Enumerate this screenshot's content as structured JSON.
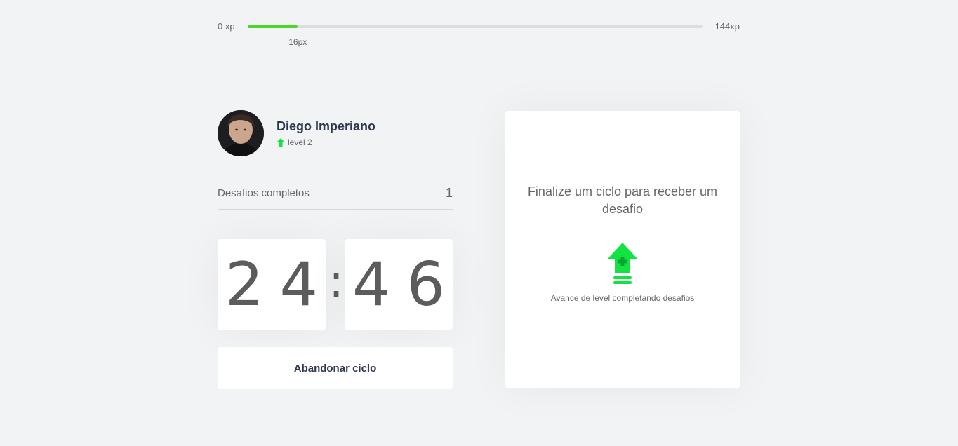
{
  "xp": {
    "min_label": "0 xp",
    "max_label": "144xp",
    "current_label": "16px",
    "progress_fraction": 0.11,
    "fill_color": "#4cd62b"
  },
  "profile": {
    "name": "Diego Imperiano",
    "level_label": "level 2",
    "level_icon": "level-up-arrow-icon"
  },
  "completed": {
    "label": "Desafios completos",
    "value": "1"
  },
  "countdown": {
    "minute_left": "2",
    "minute_right": "4",
    "separator": ":",
    "second_left": "4",
    "second_right": "6"
  },
  "abandon_button": {
    "label": "Abandonar ciclo"
  },
  "challenge_box": {
    "title": "Finalize um ciclo para receber um desafio",
    "icon": "level-up-icon",
    "hint": "Avance de level completando desafios",
    "accent_color": "#12e342"
  }
}
